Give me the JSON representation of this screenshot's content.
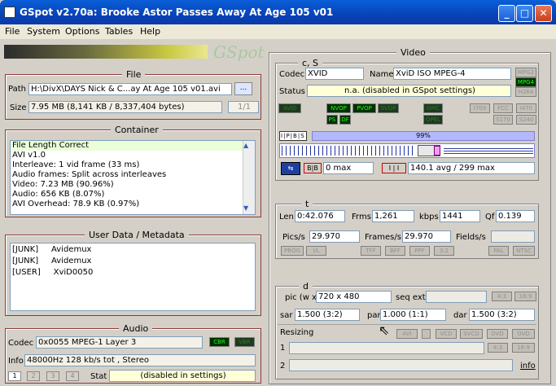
{
  "window": {
    "title": "GSpot v2.70a: Brooke Astor Passes Away At Age 105 v01",
    "logo": "GSpot"
  },
  "menu": [
    "File",
    "System",
    "Options",
    "Tables",
    "Help"
  ],
  "file": {
    "title": "File",
    "path_label": "Path",
    "path": "H:\\DivX\\DAYS  Nick & C...ay At Age 105 v01.avi",
    "browse": "...",
    "size_label": "Size",
    "size": "7.95 MB (8,141 KB / 8,337,404 bytes)",
    "page": "1/1"
  },
  "container": {
    "title": "Container",
    "lines": [
      "File Length Correct",
      "AVI v1.0",
      "Interleave: 1 vid frame (33 ms)",
      "Audio frames: Split across interleaves",
      "Video: 7.23 MB (90.96%)",
      "Audio: 656 KB (8.07%)",
      "AVI Overhead: 78.9 KB (0.97%)"
    ]
  },
  "userdata": {
    "title": "User Data / Metadata",
    "lines": [
      "[JUNK]     Avidemux",
      "[JUNK]     Avidemux",
      "[USER]     XviD0050"
    ]
  },
  "audio": {
    "title": "Audio",
    "codec_label": "Codec",
    "codec": "0x0055 MPEG-1 Layer 3",
    "cbr": "CBR",
    "vbr": "VBR",
    "info_label": "Info",
    "info": "48000Hz  128 kb/s tot , Stereo",
    "tabs": [
      "1",
      "2",
      "3",
      "4"
    ],
    "stat_label": "Stat",
    "stat": "(disabled in settings)"
  },
  "video": {
    "title": "Video",
    "cs": {
      "title": "c, S",
      "codec_label": "Codec",
      "codec": "XVID",
      "name_label": "Name",
      "name": "XviD ISO MPEG-4",
      "status_label": "Status",
      "status": "n.a. (disabled in GSpot settings)",
      "tags": [
        "MPG2",
        "MPG4",
        "H264"
      ]
    },
    "leds_row1": [
      "AVID",
      "NVOP",
      "PVOP",
      "SVOP",
      "GMC",
      "I709",
      "FCC",
      "I470"
    ],
    "leds_row2": [
      "PS",
      "DF",
      "QPEL",
      "S170",
      "S240"
    ],
    "gop": {
      "frames": [
        "I",
        "P",
        "B",
        "S"
      ],
      "percent": "99%",
      "bidir_max": "0 max",
      "ip_avg": "140.1 avg / 299 max"
    },
    "t": {
      "title": "t",
      "len_label": "Len",
      "len": "0:42.076",
      "frms_label": "Frms",
      "frms": "1,261",
      "kbps_label": "kbps",
      "kbps": "1441",
      "qf_label": "Qf",
      "qf": "0.139",
      "pics_label": "Pics/s",
      "pics": "29.970",
      "frames_label": "Frames/s",
      "frames": "29.970",
      "fields_label": "Fields/s",
      "badges": [
        "PROG",
        "I/L",
        "TFF",
        "BFF",
        "PPF",
        "3:2",
        "PAL",
        "NTSC"
      ]
    },
    "d": {
      "title": "d",
      "pic_label": "pic (w x h)",
      "pic": "720 x 480",
      "seqext_label": "seq ext",
      "ar_btns": [
        "4:3",
        "16:9"
      ],
      "sar_label": "sar",
      "sar": "1.500 (3:2)",
      "par_label": "par",
      "par": "1.000 (1:1)",
      "dar_label": "dar",
      "dar": "1.500 (3:2)",
      "resizing_label": "Resizing",
      "resize_btns": [
        "AVI",
        "VCD",
        "SVCD",
        "DVD",
        "OVD"
      ],
      "row1": "1",
      "row2": "2",
      "info": "info"
    }
  }
}
